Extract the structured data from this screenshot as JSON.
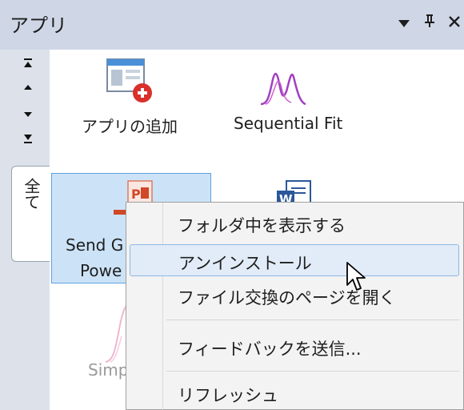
{
  "window": {
    "title": "アプリ",
    "controls": {
      "dropdown": "▼",
      "pin": "ᵖ",
      "close": "×"
    }
  },
  "sidebar": {
    "tab_label": "全て"
  },
  "apps": [
    {
      "label": "アプリの追加",
      "icon": "add-app-icon"
    },
    {
      "label": "Sequential Fit",
      "icon": "peak-fit-icon"
    },
    {
      "label": "Send G",
      "label_line2": "Powe",
      "icon": "send-powerpoint-icon"
    },
    {
      "label": "",
      "icon": "word-icon"
    },
    {
      "label": "Simp",
      "icon": "simple-app-icon"
    }
  ],
  "context_menu": {
    "items": [
      {
        "label": "フォルダ中を表示する"
      },
      {
        "label": "アンインストール"
      },
      {
        "label": "ファイル交換のページを開く"
      },
      {
        "label": "フィードバックを送信..."
      },
      {
        "label": "リフレッシュ"
      }
    ]
  },
  "colors": {
    "titlebar": "#cfd7e6",
    "selection": "#cce3f7",
    "menu_hover": "#e1ecf8",
    "accent_red": "#d9302c",
    "peak_purple": "#a040c0"
  }
}
